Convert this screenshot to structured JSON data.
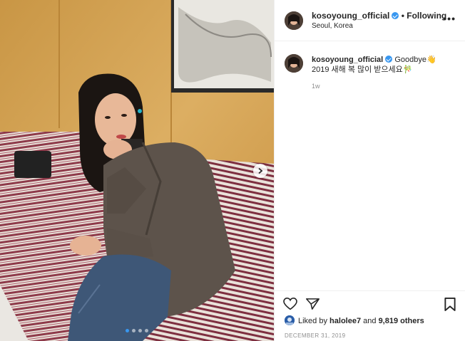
{
  "post": {
    "username": "kosoyoung_official",
    "follow_separator": "•",
    "follow_label": "Following",
    "location": "Seoul, Korea",
    "more_label": "•••",
    "caption": {
      "username": "kosoyoung_official",
      "text_line1": "Goodbye",
      "wave_emoji": "👋",
      "text_line2": "2019 새해 복 많이 받으세요🎋"
    },
    "time_ago": "1w",
    "likes": {
      "prefix": "Liked by",
      "liker": "halolee7",
      "middle": "and",
      "count": "9,819 others"
    },
    "date": "DECEMBER 31, 2019",
    "carousel": {
      "total": 4,
      "current": 1
    }
  },
  "colors": {
    "accent": "#3897f0",
    "text": "#262626",
    "muted": "#8e8e8e"
  },
  "icons": {
    "heart": "heart-icon",
    "share": "paper-plane-icon",
    "save": "bookmark-icon",
    "next": "chevron-right-icon",
    "more": "ellipsis-icon"
  }
}
